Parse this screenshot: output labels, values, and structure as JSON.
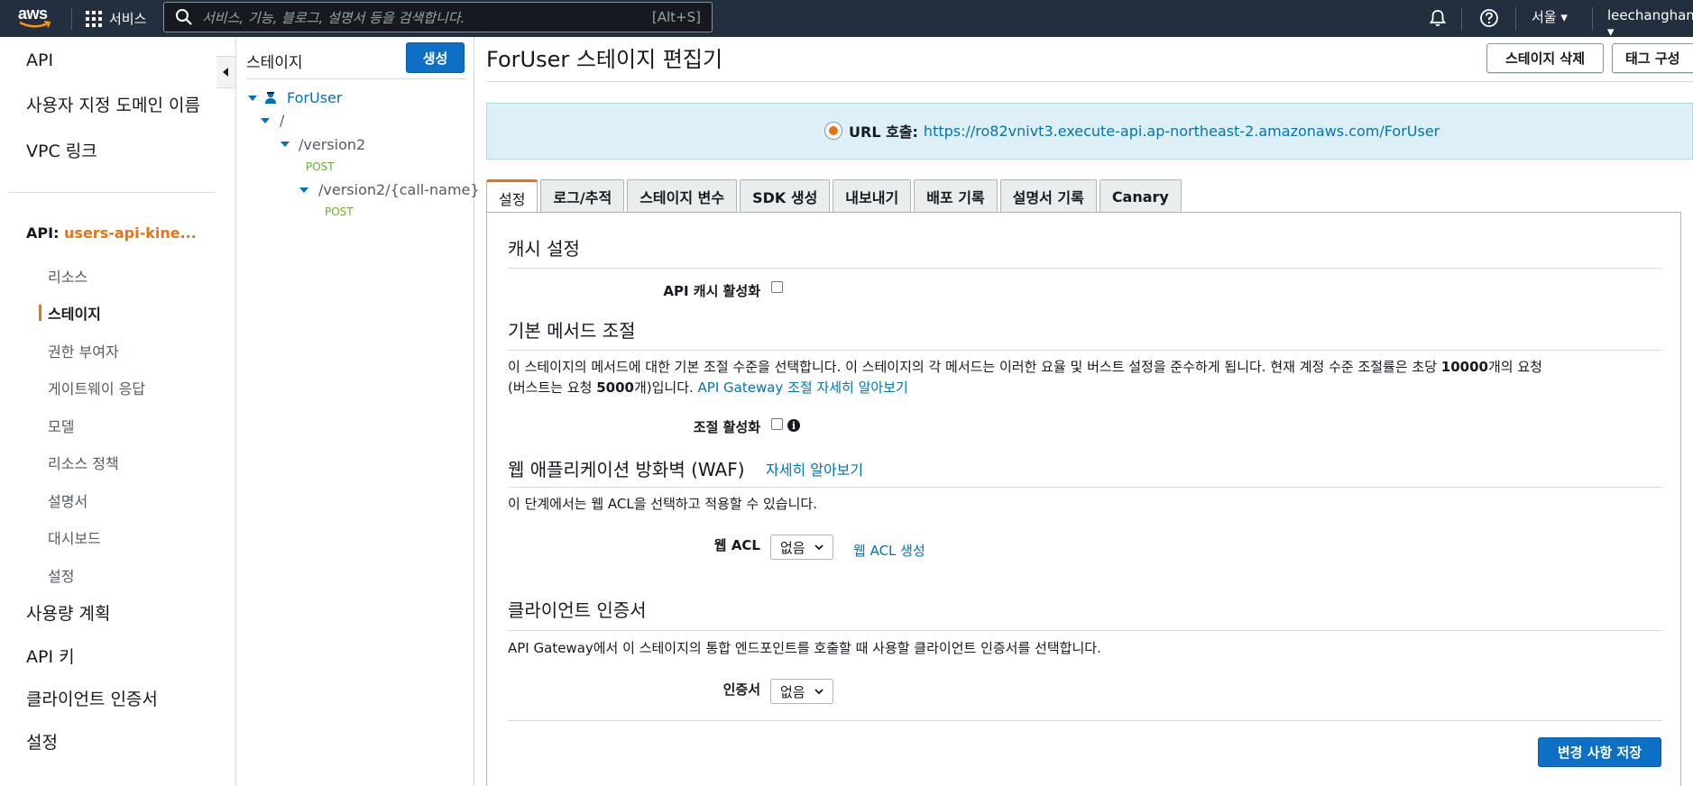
{
  "topnav": {
    "logo_text": "aws",
    "services_label": "서비스",
    "search_placeholder": "서비스, 기능, 블로그, 설명서 등을 검색합니다.",
    "search_shortcut": "[Alt+S]",
    "region_label": "서울 ▾",
    "user_label": "leechanghan ▾"
  },
  "sidebar": {
    "top_items": [
      "API",
      "사용자 지정 도메인 이름",
      "VPC 링크"
    ],
    "api_prefix": "API: ",
    "api_name": "users-api-kine...",
    "sub_items": [
      "리소스",
      "스테이지",
      "권한 부여자",
      "게이트웨이 응답",
      "모델",
      "리소스 정책",
      "설명서",
      "대시보드",
      "설정"
    ],
    "active_item": "스테이지",
    "bottom_items": [
      "사용량 계획",
      "API 키",
      "클라이언트 인증서",
      "설정"
    ]
  },
  "tree": {
    "header": "스테이지",
    "create_button": "생성",
    "stage_name": "ForUser",
    "nodes": [
      "/",
      "/version2",
      "POST",
      "/version2/{call-name}",
      "POST"
    ]
  },
  "main": {
    "title": "ForUser 스테이지 편집기",
    "delete_button": "스테이지 삭제",
    "tag_button": "태그 구성",
    "url_label": "URL 호출:",
    "url_value": "https://ro82vnivt3.execute-api.ap-northeast-2.amazonaws.com/ForUser",
    "tabs": [
      "설정",
      "로그/추적",
      "스테이지 변수",
      "SDK 생성",
      "내보내기",
      "배포 기록",
      "설명서 기록",
      "Canary"
    ],
    "active_tab": "설정"
  },
  "cache": {
    "title": "캐시 설정",
    "enable_label": "API 캐시 활성화",
    "enabled": false
  },
  "throttle": {
    "title": "기본 메서드 조절",
    "desc_part1": "이 스테이지의 메서드에 대한 기본 조절 수준을 선택합니다. 이 스테이지의 각 메서드는 이러한 요율 및 버스트 설정을 준수하게 됩니다. 현재 계정 수준 조절률은 초당 ",
    "rate_value": "10000",
    "desc_part2": "개의 요청",
    "desc_part3": "(버스트는 요청 ",
    "burst_value": "5000",
    "desc_part4": "개)입니다. ",
    "learn_more_link": "API Gateway 조절 자세히 알아보기",
    "enable_label": "조절 활성화",
    "enabled": false
  },
  "waf": {
    "title": "웹 애플리케이션 방화벽 (WAF)",
    "learn_more_link": "자세히 알아보기",
    "desc": "이 단계에서는 웹 ACL을 선택하고 적용할 수 있습니다.",
    "acl_label": "웹 ACL",
    "acl_value": "없음",
    "create_acl_link": "웹 ACL 생성"
  },
  "client_cert": {
    "title": "클라이언트 인증서",
    "desc": "API Gateway에서 이 스테이지의 통합 엔드포인트를 호출할 때 사용할 클라이언트 인증서를 선택합니다.",
    "cert_label": "인증서",
    "cert_value": "없음"
  },
  "footer": {
    "save_button": "변경 사항 저장"
  },
  "colors": {
    "nav_bg": "#232f3e",
    "accent_orange": "#ec7211",
    "primary_blue": "#0e6fc7",
    "link_blue": "#0073bb",
    "post_green": "#6aaf35"
  }
}
